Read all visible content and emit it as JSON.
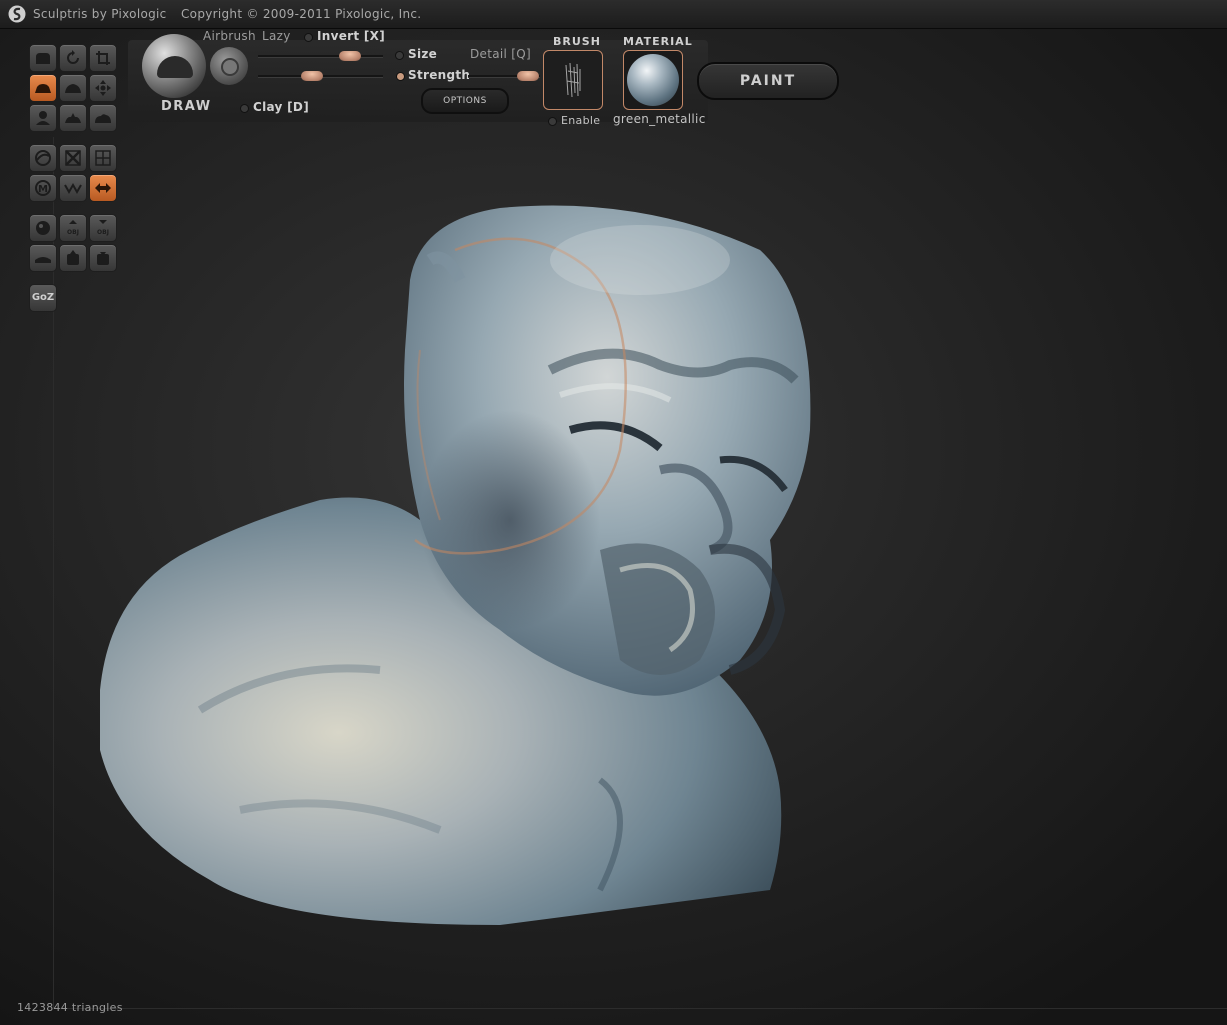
{
  "titlebar": {
    "app_title": "Sculptris by Pixologic",
    "copyright": "Copyright © 2009-2011 Pixologic, Inc."
  },
  "brush": {
    "tool_name": "DRAW",
    "airbrush_label": "Airbrush",
    "lazy_label": "Lazy",
    "invert_label": "Invert [X]",
    "size_label": "Size",
    "detail_label": "Detail [Q]",
    "strength_label": "Strength",
    "clay_label": "Clay [D]",
    "options_label": "OPTIONS",
    "brush_title": "BRUSH",
    "enable_label": "Enable",
    "material_title": "MATERIAL",
    "material_name": "green_metallic",
    "paint_label": "PAINT",
    "size_level": 0.75,
    "strength_level": 0.45,
    "detail_level": 0.8
  },
  "left_toolbar": {
    "goz_label": "GoZ",
    "active_tools": [
      "flatten-tool",
      "symmetry-tool"
    ],
    "accent_color": "#e07a3e"
  },
  "status": {
    "triangles": "1423844 triangles"
  }
}
